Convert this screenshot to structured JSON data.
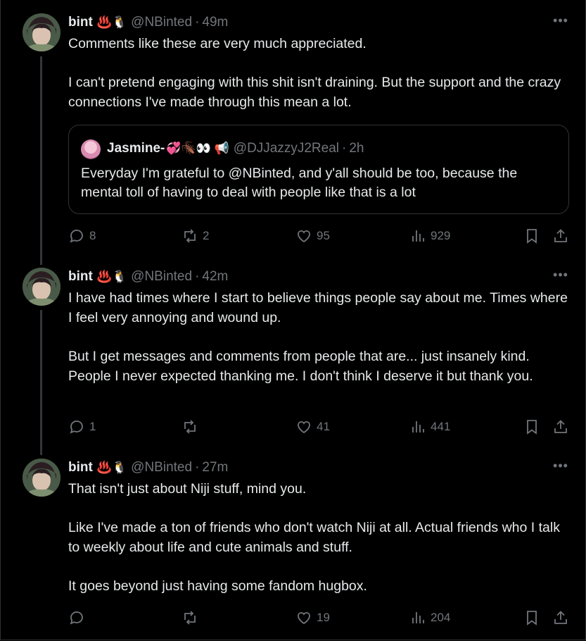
{
  "tweets": [
    {
      "name": "bint",
      "emoji": "♨️🐧",
      "handle": "@NBinted",
      "time": "49m",
      "paragraphs": [
        "Comments like these are very much appreciated.",
        "I can't pretend engaging with this shit isn't draining. But the support and the crazy connections I've made through this mean a lot."
      ],
      "quote": {
        "name": "Jasmine-",
        "emoji": "💞🪳👀 📢",
        "handle": "@DJJazzyJ2Real",
        "time": "2h",
        "text": "Everyday I'm grateful to @NBinted, and y'all should be too, because the mental toll of having to deal with people like that is a lot"
      },
      "replies": "8",
      "reposts": "2",
      "likes": "95",
      "views": "929"
    },
    {
      "name": "bint",
      "emoji": "♨️🐧",
      "handle": "@NBinted",
      "time": "42m",
      "paragraphs": [
        "I have had times where I start to believe things people say about me. Times where I feel very annoying and wound up.",
        "But I get messages and comments from people that are... just insanely kind. People I never expected thanking me. I don't think I deserve it but thank you."
      ],
      "replies": "1",
      "reposts": "",
      "likes": "41",
      "views": "441"
    },
    {
      "name": "bint",
      "emoji": "♨️🐧",
      "handle": "@NBinted",
      "time": "27m",
      "paragraphs": [
        "That isn't just about Niji stuff, mind you.",
        "Like I've made a ton of friends who don't watch Niji at all. Actual friends who I talk to weekly about life and cute animals and stuff.",
        "It goes beyond just having some fandom hugbox."
      ],
      "replies": "",
      "reposts": "",
      "likes": "19",
      "views": "204"
    }
  ],
  "icons": {
    "reply": "reply-icon",
    "repost": "repost-icon",
    "like": "heart-icon",
    "views": "views-icon",
    "bookmark": "bookmark-icon",
    "share": "share-icon",
    "more": "more-icon"
  },
  "colors": {
    "background": "#000000",
    "text": "#e7e9ea",
    "muted": "#71767b",
    "border": "#2f3336"
  }
}
